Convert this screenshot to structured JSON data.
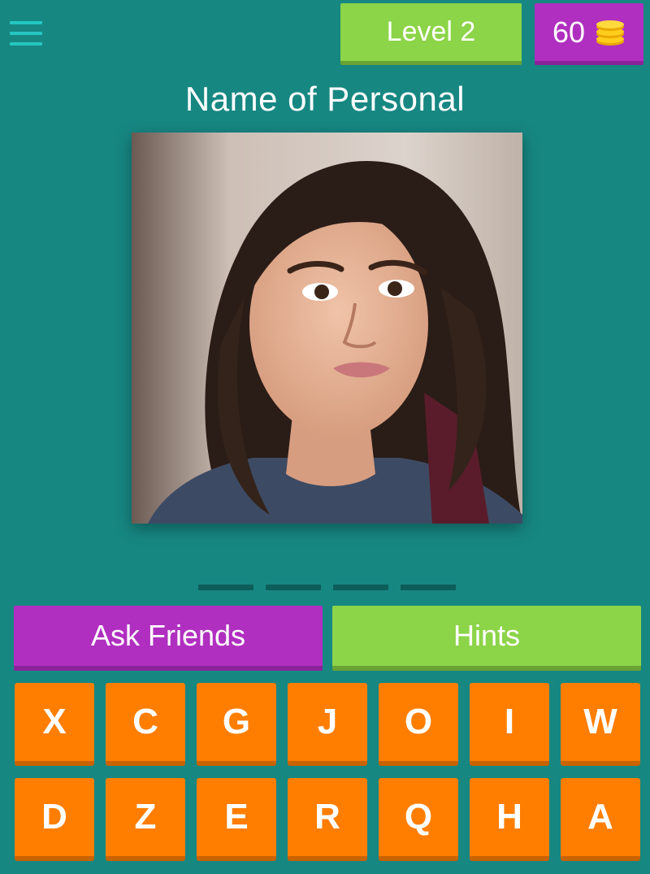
{
  "header": {
    "menu_icon": "hamburger-menu-icon",
    "level_label": "Level 2",
    "coins": "60",
    "coin_icon": "coin-stack-icon"
  },
  "question": {
    "title": "Name of Personal"
  },
  "answer": {
    "slot_count": 4
  },
  "actions": {
    "ask_friends": "Ask Friends",
    "hints": "Hints"
  },
  "keyboard": {
    "rows": [
      [
        "X",
        "C",
        "G",
        "J",
        "O",
        "I",
        "W"
      ],
      [
        "D",
        "Z",
        "E",
        "R",
        "Q",
        "H",
        "A"
      ]
    ]
  },
  "colors": {
    "background": "#178782",
    "purple": "#b02fc0",
    "green": "#8cd448",
    "orange": "#ff7e00",
    "menu": "#25c6c1"
  }
}
